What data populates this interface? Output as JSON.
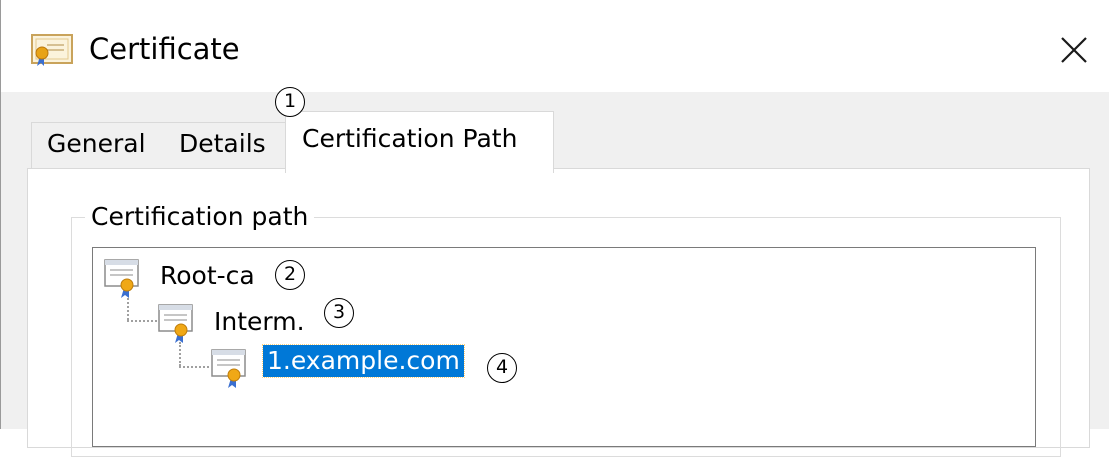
{
  "window": {
    "title": "Certificate",
    "icon": "certificate-icon",
    "close_icon": "close-icon"
  },
  "tabs": [
    {
      "label": "General",
      "selected": false
    },
    {
      "label": "Details",
      "selected": false
    },
    {
      "label": "Certification Path",
      "selected": true
    }
  ],
  "panel": {
    "group_label": "Certification path",
    "tree": [
      {
        "label": "Root-ca",
        "level": 0,
        "selected": false
      },
      {
        "label": "Interm.",
        "level": 1,
        "selected": false
      },
      {
        "label": "1.example.com",
        "level": 2,
        "selected": true
      }
    ]
  },
  "callouts": [
    "1",
    "2",
    "3",
    "4"
  ],
  "colors": {
    "selection": "#0078d7",
    "dialog_background": "#f0f0f0",
    "panel_background": "#ffffff"
  }
}
